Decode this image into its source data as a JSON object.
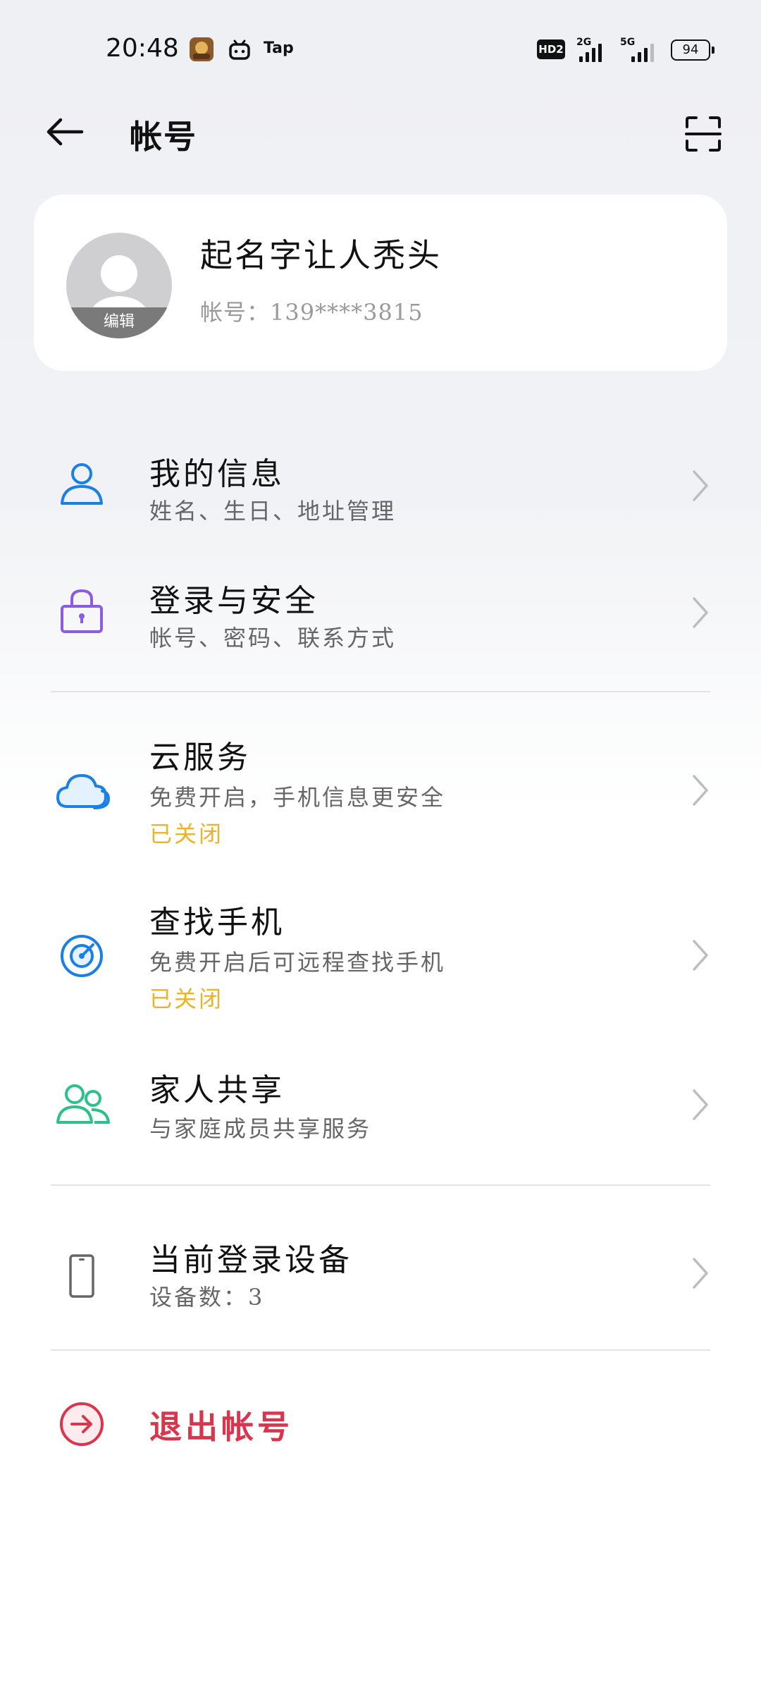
{
  "status_bar": {
    "time": "20:48",
    "tap_label": "Tap",
    "hd_label": "HD2",
    "net1": "2G",
    "net2": "5G",
    "battery": "94"
  },
  "header": {
    "title": "帐号"
  },
  "profile": {
    "avatar_edit_label": "编辑",
    "username": "起名字让人秃头",
    "account_line": "帐号：139****3815"
  },
  "menu": {
    "my_info": {
      "label": "我的信息",
      "sub": "姓名、生日、地址管理",
      "icon": "person-icon"
    },
    "login_security": {
      "label": "登录与安全",
      "sub": "帐号、密码、联系方式",
      "icon": "lock-icon"
    },
    "cloud": {
      "label": "云服务",
      "sub": "免费开启，手机信息更安全",
      "status": "已关闭",
      "icon": "cloud-icon"
    },
    "find_phone": {
      "label": "查找手机",
      "sub": "免费开启后可远程查找手机",
      "status": "已关闭",
      "icon": "radar-icon"
    },
    "family": {
      "label": "家人共享",
      "sub": "与家庭成员共享服务",
      "icon": "family-icon"
    },
    "devices": {
      "label": "当前登录设备",
      "sub": "设备数：3",
      "icon": "phone-icon"
    },
    "logout": {
      "label": "退出帐号",
      "icon": "logout-icon"
    }
  },
  "colors": {
    "accent_blue": "#1a7fe6",
    "lock_purple": "#8a5ce0",
    "family_green": "#2cc08a",
    "status_off_yellow": "#e9b42a",
    "logout_red": "#d9354c"
  }
}
